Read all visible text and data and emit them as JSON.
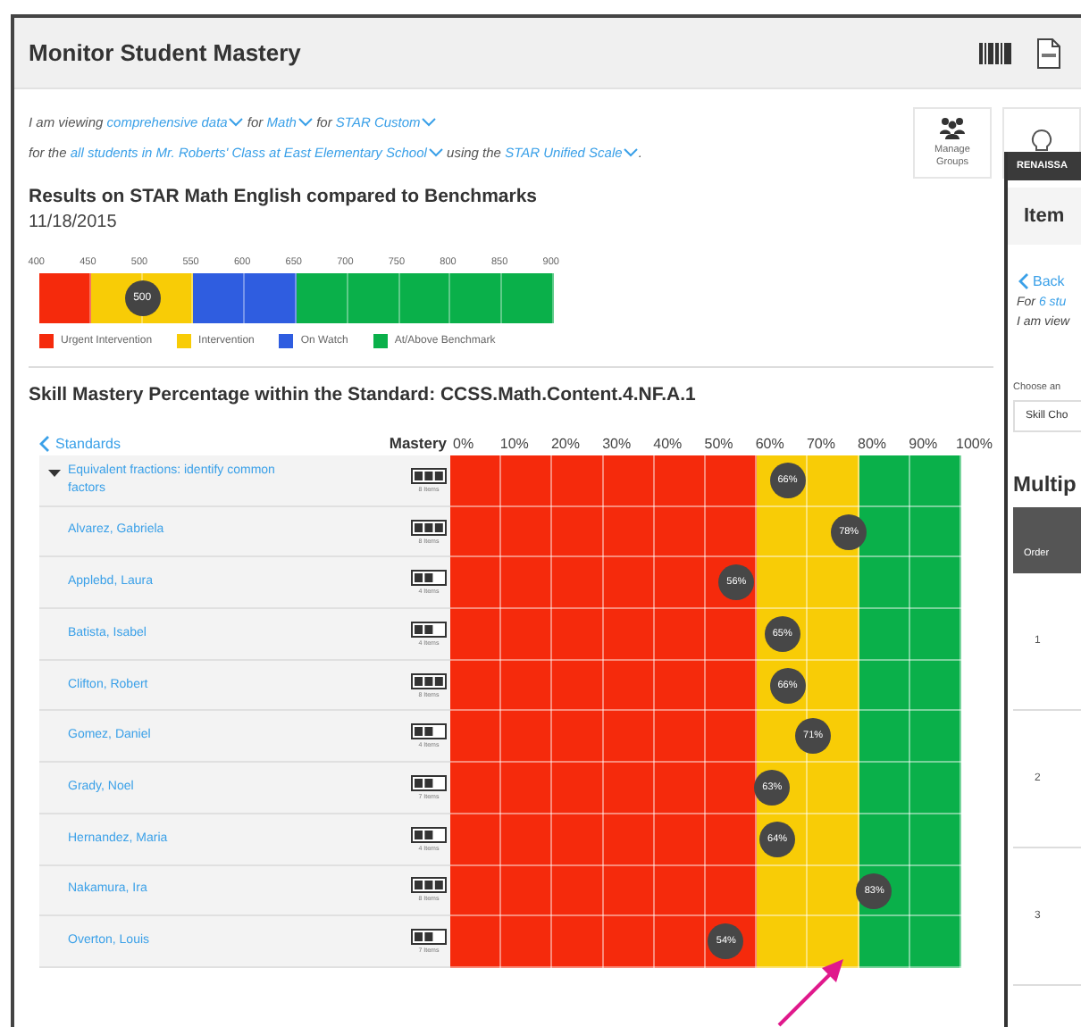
{
  "header": {
    "title": "Monitor Student Mastery"
  },
  "filters": [
    {
      "parts": [
        {
          "kind": "text",
          "text": "I am viewing"
        },
        {
          "kind": "link",
          "text": "comprehensive data"
        },
        {
          "kind": "text",
          "text": "for"
        },
        {
          "kind": "link",
          "text": "Math"
        },
        {
          "kind": "text",
          "text": "for"
        },
        {
          "kind": "link",
          "text": "STAR Custom"
        }
      ]
    },
    {
      "parts": [
        {
          "kind": "text",
          "text": "for the"
        },
        {
          "kind": "link",
          "text": "all students in Mr. Roberts' Class at East Elementary School"
        },
        {
          "kind": "text",
          "text": "using the"
        },
        {
          "kind": "link",
          "text": "STAR Unified Scale"
        },
        {
          "kind": "text",
          "text": "."
        }
      ]
    }
  ],
  "actions": [
    {
      "kind": "groups",
      "label": "Manage Groups"
    },
    {
      "kind": "bulb"
    }
  ],
  "results": {
    "title": "Results on STAR Math English compared to Benchmarks",
    "date": "11/18/2015",
    "ticks": [
      "400",
      "450",
      "500",
      "550",
      "600",
      "650",
      "700",
      "750",
      "800",
      "850",
      "900"
    ],
    "segments": [
      {
        "color": "#f52a0c"
      },
      {
        "color": "#f8cc06"
      },
      {
        "color": "#f8cc06"
      },
      {
        "color": "#2f5de0"
      },
      {
        "color": "#2f5de0"
      },
      {
        "color": "#0ab04a"
      },
      {
        "color": "#0ab04a"
      },
      {
        "color": "#0ab04a"
      },
      {
        "color": "#0ab04a"
      },
      {
        "color": "#0ab04a"
      }
    ],
    "marker": {
      "label": "500",
      "level": 0.2
    },
    "legend": [
      {
        "label": "Urgent Intervention",
        "color": "#f52a0c"
      },
      {
        "label": "Intervention",
        "color": "#f8cc06"
      },
      {
        "label": "On Watch",
        "color": "#2f5de0"
      },
      {
        "label": "At/Above Benchmark",
        "color": "#0ab04a"
      }
    ]
  },
  "mastery": {
    "title": "Skill Mastery Percentage within the Standard: CCSS.Math.Content.4.NF.A.1",
    "back": "Standards",
    "column_label": "Mastery",
    "ticks": [
      "0%",
      "10%",
      "20%",
      "30%",
      "40%",
      "50%",
      "60%",
      "70%",
      "80%",
      "90%",
      "100%"
    ],
    "rows": [
      {
        "kind": "skill",
        "name": "Equivalent fractions: identify common factors",
        "items": "8 Items",
        "full": true,
        "value": "66%",
        "level": 0.66
      },
      {
        "kind": "student",
        "name": "Alvarez, Gabriela",
        "items": "8 Items",
        "full": true,
        "value": "78%",
        "level": 0.78
      },
      {
        "kind": "student",
        "name": "Applebd, Laura",
        "items": "4 Items",
        "full": false,
        "value": "56%",
        "level": 0.56
      },
      {
        "kind": "student",
        "name": "Batista, Isabel",
        "items": "4 Items",
        "full": false,
        "value": "65%",
        "level": 0.65
      },
      {
        "kind": "student",
        "name": "Clifton, Robert",
        "items": "8 Items",
        "full": true,
        "value": "66%",
        "level": 0.66
      },
      {
        "kind": "student",
        "name": "Gomez, Daniel",
        "items": "4 Items",
        "full": false,
        "value": "71%",
        "level": 0.71
      },
      {
        "kind": "student",
        "name": "Grady, Noel",
        "items": "7 Items",
        "full": false,
        "value": "63%",
        "level": 0.63
      },
      {
        "kind": "student",
        "name": "Hernandez, Maria",
        "items": "4 Items",
        "full": false,
        "value": "64%",
        "level": 0.64
      },
      {
        "kind": "student",
        "name": "Nakamura, Ira",
        "items": "8 Items",
        "full": true,
        "value": "83%",
        "level": 0.83
      },
      {
        "kind": "student",
        "name": "Overton, Louis",
        "items": "7 Items",
        "full": false,
        "value": "54%",
        "level": 0.54
      }
    ]
  },
  "panel": {
    "brand": "RENAISSA",
    "title": "Item",
    "back": "Back",
    "line_1": {
      "text": "For",
      "link": "6 stu"
    },
    "line_2": "I am view",
    "choose_label": "Choose an",
    "select_value": "Skill Cho",
    "section": "Multip",
    "column": "Order",
    "rows": [
      "1",
      "2",
      "3"
    ]
  }
}
